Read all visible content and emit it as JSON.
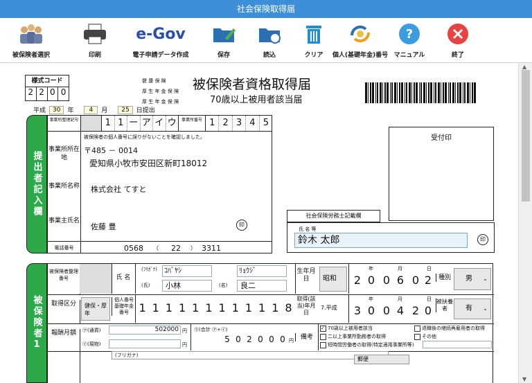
{
  "window": {
    "title": "社会保険取得届"
  },
  "toolbar": {
    "buttons": [
      {
        "label": "被保険者選択",
        "icon": "people-icon"
      },
      {
        "label": "印刷",
        "icon": "printer-icon"
      },
      {
        "label": "電子申請データ作成",
        "icon": "egov-logo-icon",
        "logo": "e-Gov"
      },
      {
        "label": "保存",
        "icon": "save-folder-icon"
      },
      {
        "label": "読込",
        "icon": "open-folder-icon"
      },
      {
        "label": "クリア",
        "icon": "trash-icon"
      },
      {
        "label": "個人(基礎年金)番号",
        "icon": "person-number-icon"
      },
      {
        "label": "マニュアル",
        "icon": "help-icon"
      },
      {
        "label": "終了",
        "icon": "close-icon"
      }
    ]
  },
  "form": {
    "form_code_label": "様式コード",
    "form_code_digits": [
      "2",
      "2",
      "0",
      "0"
    ],
    "insurance_types": [
      "健 康 保 険",
      "厚 生 年 金 保 険",
      "厚 生 年 金 保 険"
    ],
    "title": "被保険者資格取得届",
    "subtitle": "70歳以上被用者該当届",
    "date": {
      "era": "平成",
      "year": "30",
      "year_unit": "年",
      "month": "4",
      "month_unit": "月",
      "day": "25",
      "day_unit": "日提出"
    },
    "submitter": {
      "section_label": "提出者記入欄",
      "office_code_label": "事業所整理記号",
      "office_code_chars": [
        "1",
        "1",
        "ー",
        "ア",
        "イ",
        "ウ"
      ],
      "office_num_label": "事業所番号",
      "office_num_digits": [
        "1",
        "2",
        "3",
        "4",
        "5"
      ],
      "confirm_note": "被保険者の個人番号に誤りがないことを確認しました。",
      "address_label": "事業所所在地",
      "postal": "〒485 － 0014",
      "address": "愛知県小牧市安田区新町18012",
      "name_label": "事業所名称",
      "company_name": "株式会社 てすと",
      "owner_label": "事業主氏名",
      "owner_name": "佐藤 豊",
      "seal": "印",
      "phone_label": "電話番号",
      "phone": [
        "0568",
        "（",
        "22",
        "）",
        "3311"
      ]
    },
    "receipt": {
      "label": "受付印"
    },
    "labor_consultant": {
      "label": "社会保険労務士記載欄",
      "name_label": "氏 名 等",
      "name_value": "鈴木 太郎",
      "seal": "印"
    },
    "insured": {
      "section_label": "被保険者1",
      "ref_num_label": "被保険者整理番号",
      "name_label": "氏 名",
      "furigana_label": "(ﾌﾘｶﾞﾅ)",
      "kanji_label": "(氏)",
      "given_label": "(名)",
      "last_kana": "ｺﾊﾞﾔｼ",
      "first_kana": "ﾘｮｳｼﾞ",
      "last_name": "小林",
      "first_name": "良二",
      "birth_label": "生年月日",
      "birth_era": "昭和",
      "birth_digits": [
        "2",
        "0",
        "0",
        "6",
        "0",
        "2"
      ],
      "ymd": [
        "年",
        "月",
        "日"
      ],
      "gender_label": "種別",
      "gender": "男",
      "type_label": "取得区分",
      "type_value": "健保・厚年",
      "id_label": "個人番号基礎年金番号",
      "id_digits": [
        "1",
        "1",
        "1",
        "1",
        "1",
        "1",
        "1",
        "1",
        "1",
        "1",
        "1",
        "8"
      ],
      "acq_date_label": "取得(該当)年月日",
      "acq_era": "7.平成",
      "acq_digits": [
        "3",
        "0",
        "0",
        "4",
        "2",
        "0"
      ],
      "dependent_label": "被扶養者",
      "dependent": "有",
      "salary_label": "報酬月額",
      "salary_currency_label": "㋐(通貨)",
      "salary_currency": "502000",
      "yen": "円",
      "salary_goods_label": "㋑(現物)",
      "total_label": "㋒(合計 ㋐+㋑)",
      "total_digits": [
        "5",
        "0",
        "2",
        "0",
        "0",
        "0"
      ],
      "remarks_label": "備考",
      "checks": [
        {
          "label": "70歳以上被用者該当",
          "checked": true
        },
        {
          "label": "二以上事業所勤務者の取得",
          "checked": false
        },
        {
          "label": "短時間労働者の取得(特定適用事業所等)",
          "checked": false
        },
        {
          "label": "退職後の継続再雇用者の取得",
          "checked": false
        },
        {
          "label": "その他",
          "checked": false
        }
      ],
      "next_row_furigana": "(フリガナ)",
      "next_row_select": "郵便"
    }
  }
}
